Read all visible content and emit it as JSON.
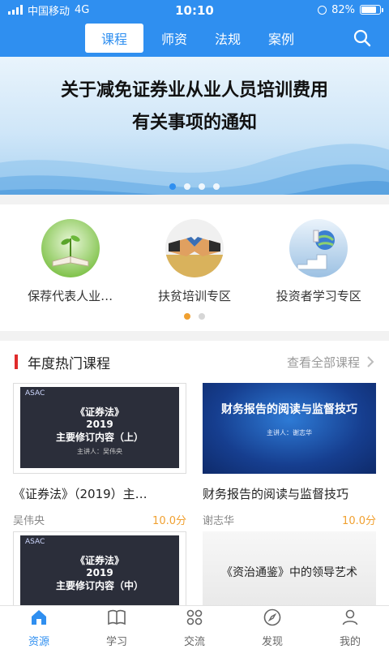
{
  "status_bar": {
    "carrier": "中国移动",
    "network": "4G",
    "time": "10:10",
    "battery": "82%",
    "battery_level": 0.82
  },
  "top_tabs": [
    {
      "label": "课程",
      "active": true
    },
    {
      "label": "师资",
      "active": false
    },
    {
      "label": "法规",
      "active": false
    },
    {
      "label": "案例",
      "active": false
    }
  ],
  "banner": {
    "line1": "关于减免证券业从业人员培训费用",
    "line2": "有关事项的通知",
    "slide_count": 4,
    "active_slide": 1
  },
  "categories": [
    {
      "label": "保荐代表人业…",
      "icon": "book-plant-icon"
    },
    {
      "label": "扶贫培训专区",
      "icon": "handshake-icon"
    },
    {
      "label": "投资者学习专区",
      "icon": "globe-stairs-icon"
    }
  ],
  "category_pages": {
    "count": 2,
    "active": 1
  },
  "hot_courses": {
    "title": "年度热门课程",
    "more": "查看全部课程",
    "courses": [
      {
        "title": "《证券法》（2019）主…",
        "teacher": "吴伟央",
        "score": "10.0分",
        "thumb": {
          "style": "dark",
          "logo": "ASAC",
          "l1": "《证券法》",
          "l2": "2019",
          "l3": "主要修订内容（上）",
          "small": "主讲人：吴伟央"
        }
      },
      {
        "title": "财务报告的阅读与监督技巧",
        "teacher": "谢志华",
        "score": "10.0分",
        "thumb": {
          "style": "blue",
          "h": "财务报告的阅读与监督技巧",
          "small": "主讲人：谢志华"
        }
      },
      {
        "title": "",
        "teacher": "",
        "score": "",
        "thumb": {
          "style": "dark",
          "logo": "ASAC",
          "l1": "《证券法》",
          "l2": "2019",
          "l3": "主要修订内容（中）",
          "small": ""
        }
      },
      {
        "title": "",
        "teacher": "",
        "score": "",
        "thumb": {
          "style": "ink",
          "h": "《资治通鉴》中的领导艺术"
        }
      }
    ]
  },
  "bottom_nav": [
    {
      "label": "资源",
      "icon": "home-icon",
      "active": true
    },
    {
      "label": "学习",
      "icon": "book-icon",
      "active": false
    },
    {
      "label": "交流",
      "icon": "four-circles-icon",
      "active": false
    },
    {
      "label": "发现",
      "icon": "compass-icon",
      "active": false
    },
    {
      "label": "我的",
      "icon": "person-icon",
      "active": false
    }
  ],
  "colors": {
    "primary": "#2f8ff0",
    "accent_orange": "#f0a030",
    "section_red": "#e02b2b"
  }
}
